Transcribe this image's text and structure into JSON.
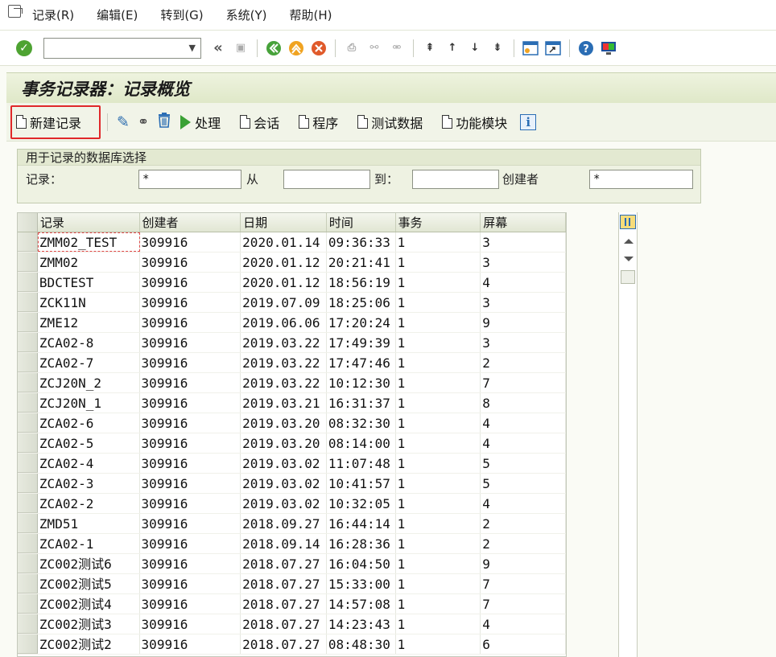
{
  "menu": {
    "items": [
      "记录(R)",
      "编辑(E)",
      "转到(G)",
      "系统(Y)",
      "帮助(H)"
    ]
  },
  "toolbar": {
    "command_value": "",
    "back_glyph": "«"
  },
  "title": "事务记录器：记录概览",
  "app_toolbar": {
    "new_record": "新建记录",
    "process": "处理",
    "session": "会话",
    "program": "程序",
    "test_data": "测试数据",
    "function_module": "功能模块"
  },
  "selection": {
    "group_title": "用于记录的数据库选择",
    "record_label": "记录：",
    "record_value": "*",
    "from_label": "从",
    "from_value": "",
    "to_label": "到：",
    "to_value": "",
    "creator_label": "创建者",
    "creator_value": "*"
  },
  "table": {
    "columns": [
      "记录",
      "创建者",
      "日期",
      "时间",
      "事务",
      "屏幕"
    ],
    "rows": [
      [
        "ZMM02_TEST",
        "309916",
        "2020.01.14",
        "09:36:33",
        "1",
        "3"
      ],
      [
        "ZMM02",
        "309916",
        "2020.01.12",
        "20:21:41",
        "1",
        "3"
      ],
      [
        "BDCTEST",
        "309916",
        "2020.01.12",
        "18:56:19",
        "1",
        "4"
      ],
      [
        "ZCK11N",
        "309916",
        "2019.07.09",
        "18:25:06",
        "1",
        "3"
      ],
      [
        "ZME12",
        "309916",
        "2019.06.06",
        "17:20:24",
        "1",
        "9"
      ],
      [
        "ZCA02-8",
        "309916",
        "2019.03.22",
        "17:49:39",
        "1",
        "3"
      ],
      [
        "ZCA02-7",
        "309916",
        "2019.03.22",
        "17:47:46",
        "1",
        "2"
      ],
      [
        "ZCJ20N_2",
        "309916",
        "2019.03.22",
        "10:12:30",
        "1",
        "7"
      ],
      [
        "ZCJ20N_1",
        "309916",
        "2019.03.21",
        "16:31:37",
        "1",
        "8"
      ],
      [
        "ZCA02-6",
        "309916",
        "2019.03.20",
        "08:32:30",
        "1",
        "4"
      ],
      [
        "ZCA02-5",
        "309916",
        "2019.03.20",
        "08:14:00",
        "1",
        "4"
      ],
      [
        "ZCA02-4",
        "309916",
        "2019.03.02",
        "11:07:48",
        "1",
        "5"
      ],
      [
        "ZCA02-3",
        "309916",
        "2019.03.02",
        "10:41:57",
        "1",
        "5"
      ],
      [
        "ZCA02-2",
        "309916",
        "2019.03.02",
        "10:32:05",
        "1",
        "4"
      ],
      [
        "ZMD51",
        "309916",
        "2018.09.27",
        "16:44:14",
        "1",
        "2"
      ],
      [
        "ZCA02-1",
        "309916",
        "2018.09.14",
        "16:28:36",
        "1",
        "2"
      ],
      [
        "ZC002测试6",
        "309916",
        "2018.07.27",
        "16:04:50",
        "1",
        "9"
      ],
      [
        "ZC002测试5",
        "309916",
        "2018.07.27",
        "15:33:00",
        "1",
        "7"
      ],
      [
        "ZC002测试4",
        "309916",
        "2018.07.27",
        "14:57:08",
        "1",
        "7"
      ],
      [
        "ZC002测试3",
        "309916",
        "2018.07.27",
        "14:23:43",
        "1",
        "4"
      ],
      [
        "ZC002测试2",
        "309916",
        "2018.07.27",
        "08:48:30",
        "1",
        "6"
      ]
    ]
  },
  "icons": [
    "menu-doc-icon",
    "enter-icon",
    "back-icon",
    "save-icon",
    "exit-icon",
    "cancel-icon",
    "print-icon",
    "find-icon",
    "find-next-icon",
    "first-page-icon",
    "prev-page-icon",
    "next-page-icon",
    "last-page-icon",
    "new-session-icon",
    "shortcut-icon",
    "help-icon",
    "customize-layout-icon",
    "edit-pencil-icon",
    "glasses-icon",
    "trash-icon",
    "execute-icon",
    "info-icon",
    "table-layout-icon"
  ],
  "colors": {
    "highlight": "#e0282a",
    "accent_blue": "#2a6db4",
    "ok_green": "#4ea332",
    "title_bg": "#dfe8c8"
  }
}
